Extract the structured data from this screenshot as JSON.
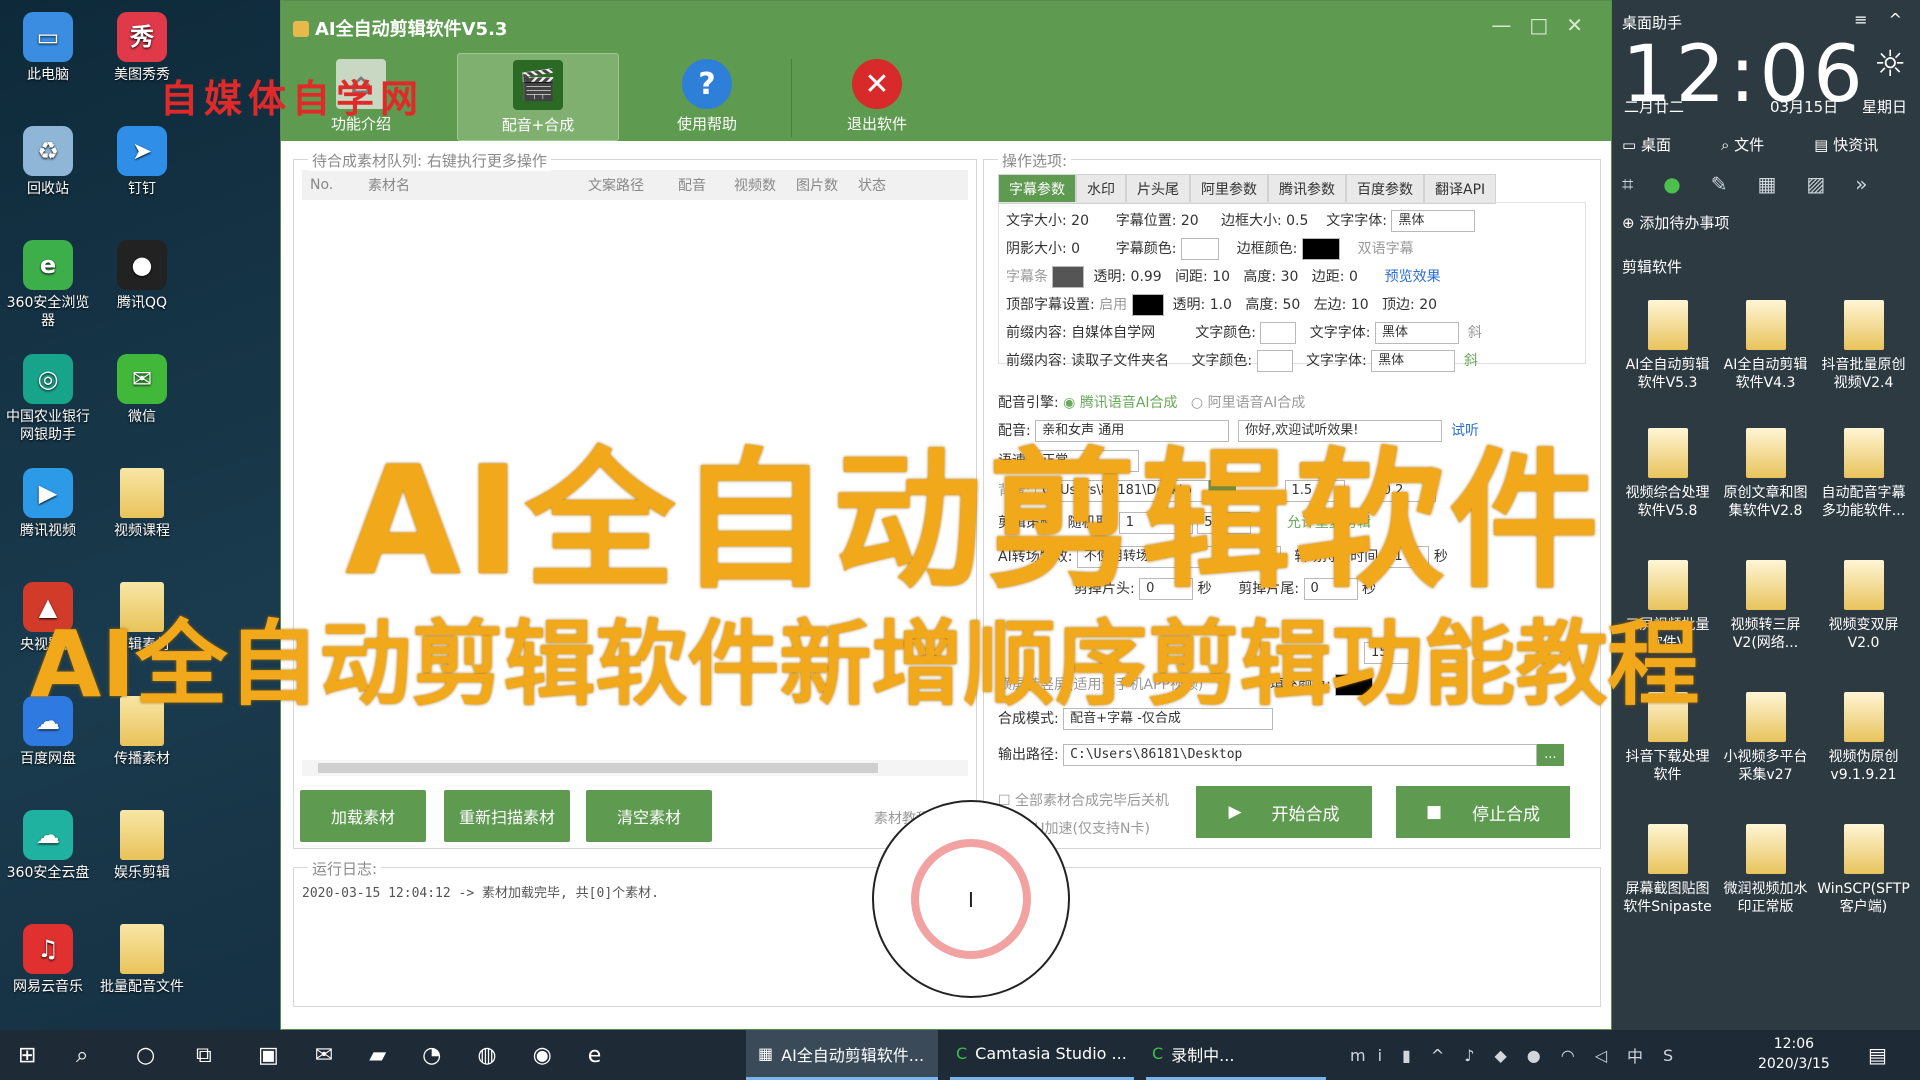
{
  "desktop": {
    "icons": [
      {
        "label": "此电脑"
      },
      {
        "label": "美图秀秀"
      },
      {
        "label": "回收站"
      },
      {
        "label": "钉钉"
      },
      {
        "label": "360安全浏览器"
      },
      {
        "label": "腾讯QQ"
      },
      {
        "label": "中国农业银行网银助手"
      },
      {
        "label": "微信"
      },
      {
        "label": "腾讯视频"
      },
      {
        "label": "视频课程"
      },
      {
        "label": "央视影音"
      },
      {
        "label": "剪辑素材"
      },
      {
        "label": "百度网盘"
      },
      {
        "label": "传播素材"
      },
      {
        "label": "360安全云盘"
      },
      {
        "label": "娱乐剪辑"
      },
      {
        "label": "网易云音乐"
      },
      {
        "label": "批量配音文件"
      }
    ]
  },
  "watermark": "自媒体自学网",
  "overlay": {
    "line1": "AI全自动剪辑软件",
    "line2": "AI全自动剪辑软件新增顺序剪辑功能教程"
  },
  "window": {
    "title": "AI全自动剪辑软件V5.3",
    "toolbar": {
      "intro": "功能介绍",
      "dub": "配音+合成",
      "help": "使用帮助",
      "exit": "退出软件"
    },
    "queue": {
      "title": "待合成素材队列: 右键执行更多操作",
      "columns": [
        "No.",
        "素材名",
        "文案路径",
        "配音",
        "视频数",
        "图片数",
        "状态"
      ]
    },
    "buttons": {
      "load": "加载素材",
      "rescan": "重新扫描素材",
      "clear": "清空素材",
      "tutorial": "素材教程"
    },
    "options": {
      "title": "操作选项:",
      "tabs": [
        "字幕参数",
        "水印",
        "片头尾",
        "阿里参数",
        "腾讯参数",
        "百度参数",
        "翻译API"
      ],
      "font_size_label": "文字大小:",
      "font_size": "20",
      "sub_pos_label": "字幕位置:",
      "sub_pos": "20",
      "border_size_label": "边框大小:",
      "border_size": "0.5",
      "font_label": "文字字体:",
      "font": "黑体",
      "shadow_label": "阴影大小:",
      "shadow": "0",
      "sub_color_label": "字幕颜色:",
      "border_color_label": "边框颜色:",
      "dual_sub": "双语字幕",
      "sub_bar": "字幕条",
      "opacity_label": "透明:",
      "opacity": "0.99",
      "gap_label": "间距:",
      "gap": "10",
      "height_label": "高度:",
      "height": "30",
      "margin_label": "边距:",
      "margin": "0",
      "preview": "预览效果",
      "top_sub_label": "顶部字幕设置:",
      "top_enable": "启用",
      "top_opacity": "1.0",
      "top_height": "50",
      "left_margin_label": "左边:",
      "left_margin": "10",
      "top_margin_label": "顶边:",
      "top_margin": "20",
      "prefix1_label": "前缀内容:",
      "prefix1": "自媒体自学网",
      "prefix2_label": "前缀内容:",
      "prefix2": "读取子文件夹名",
      "text_color_label": "文字颜色:",
      "italic": "斜",
      "engine_label": "配音引擎:",
      "engine_tx": "腾讯语音AI合成",
      "engine_ali": "阿里语音AI合成",
      "voice_label": "配音:",
      "voice": "亲和女声 通用",
      "voice_test_text": "你好,欢迎试听效果!",
      "try_listen": "试听",
      "speed_label": "语速:",
      "speed": "正常",
      "bg_label": "背景:",
      "bg_path": "C:\\Users\\86181\\Deskto",
      "browse": "...",
      "vol1": "1.5",
      "vol2": "0.2",
      "cut_label": "剪辑策略:",
      "random_label": "随机取:",
      "rand_from": "1",
      "rand_to": "5",
      "allow_repeat": "允许重复剪辑",
      "transition_label": "AI转场特效:",
      "transition": "不使用转场",
      "trans_dur_label": "转场持续时间:",
      "trans_dur": "1",
      "sec": "秒",
      "cut_head_label": "剪掉片头:",
      "cut_head": "0",
      "cut_tail_label": "剪掉片尾:",
      "cut_tail": "0",
      "pixel_val": "15",
      "landscape": "横屏转竖屏(适用于手机APP视频)",
      "fill_color_label": "填充颜色:",
      "mode_label": "合成模式:",
      "mode": "配音+字幕 -仅合成",
      "output_label": "输出路径:",
      "output": "C:\\Users\\86181\\Desktop",
      "shutdown": "全部素材合成完毕后关机",
      "gpu": "GPU加速(仅支持N卡)",
      "start": "开始合成",
      "stop": "停止合成"
    },
    "log": {
      "title": "运行日志:",
      "line": "2020-03-15 12:04:12 -> 素材加载完毕, 共[0]个素材."
    }
  },
  "sidebar": {
    "title": "桌面助手",
    "time": "12:06",
    "lunar": "二月廿二",
    "date": "03月15日",
    "weekday": "星期日",
    "nav": [
      "桌面",
      "文件",
      "快资讯"
    ],
    "todo": "添加待办事项",
    "group": "剪辑软件",
    "apps": [
      {
        "label": "AI全自动剪辑软件V5.3"
      },
      {
        "label": "AI全自动剪辑软件V4.3"
      },
      {
        "label": "抖音批量原创视频V2.4"
      },
      {
        "label": "视频综合处理软件V5.8"
      },
      {
        "label": "原创文章和图集软件V2.8"
      },
      {
        "label": "自动配音字幕多功能软件..."
      },
      {
        "label": "三屏视频批量软件V"
      },
      {
        "label": "视频转三屏V2(网络..."
      },
      {
        "label": "视频变双屏V2.0"
      },
      {
        "label": "抖音下载处理软件"
      },
      {
        "label": "小视频多平台采集v27"
      },
      {
        "label": "视频伪原创v9.1.9.21"
      },
      {
        "label": "屏幕截图贴图软件Snipaste"
      },
      {
        "label": "微润视频加水印正常版"
      },
      {
        "label": "WinSCP(SFTP客户端)"
      }
    ]
  },
  "taskbar": {
    "app1": "AI全自动剪辑软件...",
    "app2": "Camtasia Studio ...",
    "app3": "录制中...",
    "time": "12:06",
    "date": "2020/3/15"
  }
}
